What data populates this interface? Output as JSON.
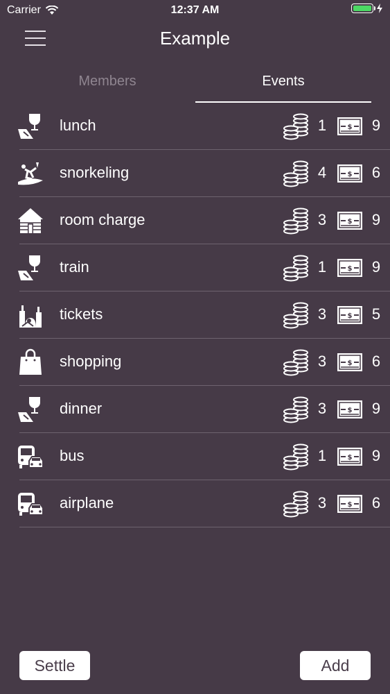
{
  "status": {
    "carrier": "Carrier",
    "time": "12:37 AM"
  },
  "nav": {
    "title": "Example"
  },
  "tabs": [
    {
      "label": "Members",
      "active": false
    },
    {
      "label": "Events",
      "active": true
    }
  ],
  "events": [
    {
      "icon": "wine-glass-icon",
      "label": "lunch",
      "count": "1",
      "amount": "9"
    },
    {
      "icon": "surfing-icon",
      "label": "snorkeling",
      "count": "4",
      "amount": "6"
    },
    {
      "icon": "cabin-icon",
      "label": "room charge",
      "count": "3",
      "amount": "9"
    },
    {
      "icon": "wine-glass-icon",
      "label": "train",
      "count": "1",
      "amount": "9"
    },
    {
      "icon": "city-icon",
      "label": "tickets",
      "count": "3",
      "amount": "5"
    },
    {
      "icon": "shopping-bag-icon",
      "label": "shopping",
      "count": "3",
      "amount": "6"
    },
    {
      "icon": "wine-glass-icon",
      "label": "dinner",
      "count": "3",
      "amount": "9"
    },
    {
      "icon": "bus-car-icon",
      "label": "bus",
      "count": "1",
      "amount": "9"
    },
    {
      "icon": "bus-car-icon",
      "label": "airplane",
      "count": "3",
      "amount": "6"
    }
  ],
  "buttons": {
    "settle": "Settle",
    "add": "Add"
  },
  "colors": {
    "background": "#463a47",
    "battery": "#4cd964",
    "inactive_tab": "#8f8590"
  }
}
